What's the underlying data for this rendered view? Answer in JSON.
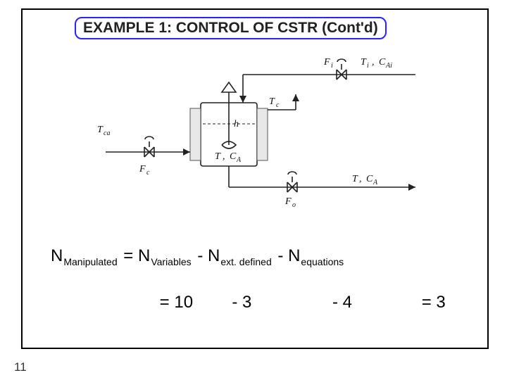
{
  "title": "EXAMPLE 1: CONTROL OF CSTR (Cont'd)",
  "page_number": "11",
  "diagram_labels": {
    "Tca": "T",
    "Tca_sub": "ca",
    "Fc": "F",
    "Fc_sub": "c",
    "Tc": "T",
    "Tc_sub": "c",
    "h": "h",
    "T": "T",
    "CA": "C",
    "CA_sub": "A",
    "Fi": "F",
    "Fi_sub": "i",
    "Ti": "T",
    "Ti_sub": "i",
    "CAi": "C",
    "CAi_sub": "Ai",
    "Fo": "F",
    "Fo_sub": "o",
    "To": "T",
    "To_sub": "",
    "CAo": "C",
    "CAo_sub": "A"
  },
  "equation": {
    "lhs_symbol": "N",
    "lhs_sub": "Manipulated",
    "eq": " = ",
    "r1_sym": "N",
    "r1_sub": "Variables",
    "minus1": " - ",
    "r2_sym": "N",
    "r2_sub": "ext. defined",
    "minus2": "- ",
    "r3_sym": "N",
    "r3_sub": "equations"
  },
  "values": {
    "eq10": "= 10",
    "m3": "- 3",
    "m4": "- 4",
    "eq3": "= 3"
  }
}
